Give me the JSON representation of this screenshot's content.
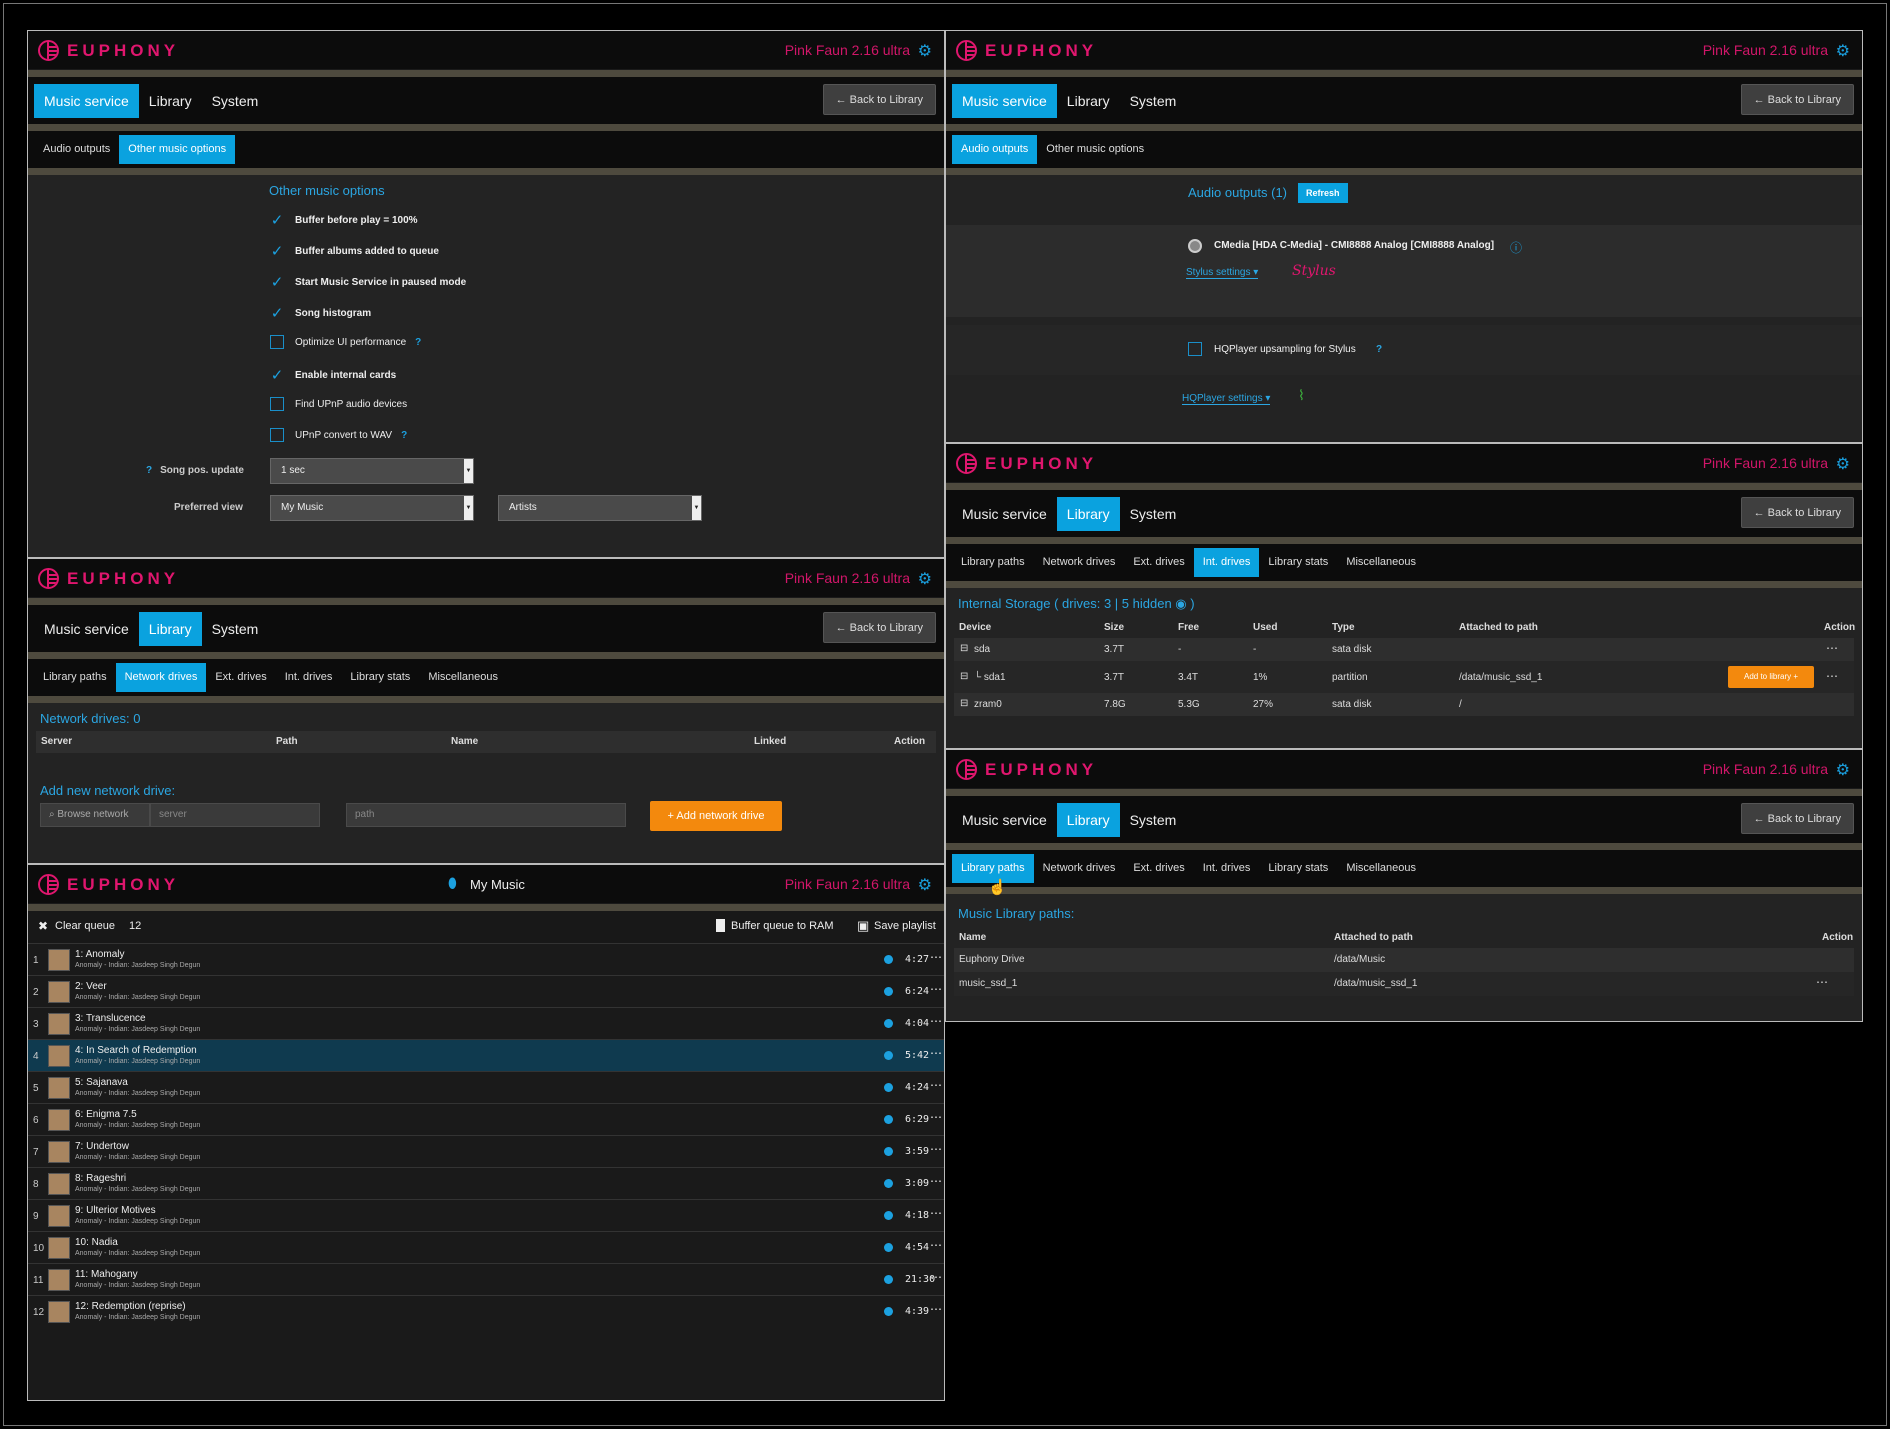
{
  "brand": {
    "logo": "EUPHONY",
    "version": "Pink Faun 2.16 ultra"
  },
  "tabs": {
    "music_service": "Music service",
    "library": "Library",
    "system": "System",
    "back": "← Back to Library"
  },
  "music_subtabs": {
    "audio_outputs": "Audio outputs",
    "other_options": "Other music options"
  },
  "library_subtabs": {
    "paths": "Library paths",
    "network": "Network drives",
    "ext": "Ext. drives",
    "int": "Int. drives",
    "stats": "Library stats",
    "misc": "Miscellaneous"
  },
  "other_options": {
    "title": "Other music options",
    "items": [
      {
        "label": "Buffer before play = 100%",
        "checked": true
      },
      {
        "label": "Buffer albums added to queue",
        "checked": true
      },
      {
        "label": "Start Music Service in paused mode",
        "checked": true
      },
      {
        "label": "Song histogram",
        "checked": true
      },
      {
        "label": "Optimize UI performance",
        "checked": false,
        "help": "?"
      },
      {
        "label": "Enable internal cards",
        "checked": true
      },
      {
        "label": "Find UPnP audio devices",
        "checked": false
      },
      {
        "label": "UPnP convert to WAV",
        "checked": false,
        "help": "?"
      }
    ],
    "song_pos_label": "Song pos. update",
    "song_pos_help": "?",
    "song_pos_value": "1 sec",
    "preferred_view_label": "Preferred view",
    "preferred_view_value": "My Music",
    "preferred_view_value2": "Artists"
  },
  "network_drives": {
    "title": "Network drives: 0",
    "columns": [
      "Server",
      "Path",
      "Name",
      "Linked",
      "Action"
    ],
    "add_title": "Add new network drive:",
    "browse": "Browse network",
    "server_ph": "server",
    "path_ph": "path",
    "add_button": "+ Add network drive"
  },
  "queue": {
    "location": "My Music",
    "clear": "Clear queue",
    "count": "12",
    "buffer": "Buffer queue to RAM",
    "save": "Save playlist",
    "rows": [
      {
        "n": "1",
        "title": "1: Anomaly",
        "sub": "Anomaly - Indian: Jasdeep Singh Degun",
        "dur": "4:27"
      },
      {
        "n": "2",
        "title": "2: Veer",
        "sub": "Anomaly - Indian: Jasdeep Singh Degun",
        "dur": "6:24"
      },
      {
        "n": "3",
        "title": "3: Translucence",
        "sub": "Anomaly - Indian: Jasdeep Singh Degun",
        "dur": "4:04"
      },
      {
        "n": "4",
        "title": "4: In Search of Redemption",
        "sub": "Anomaly - Indian: Jasdeep Singh Degun",
        "dur": "5:42",
        "active": true
      },
      {
        "n": "5",
        "title": "5: Sajanava",
        "sub": "Anomaly - Indian: Jasdeep Singh Degun",
        "dur": "4:24"
      },
      {
        "n": "6",
        "title": "6: Enigma 7.5",
        "sub": "Anomaly - Indian: Jasdeep Singh Degun",
        "dur": "6:29"
      },
      {
        "n": "7",
        "title": "7: Undertow",
        "sub": "Anomaly - Indian: Jasdeep Singh Degun",
        "dur": "3:59"
      },
      {
        "n": "8",
        "title": "8: Rageshri",
        "sub": "Anomaly - Indian: Jasdeep Singh Degun",
        "dur": "3:09"
      },
      {
        "n": "9",
        "title": "9: Ulterior Motives",
        "sub": "Anomaly - Indian: Jasdeep Singh Degun",
        "dur": "4:18"
      },
      {
        "n": "10",
        "title": "10: Nadia",
        "sub": "Anomaly - Indian: Jasdeep Singh Degun",
        "dur": "4:54"
      },
      {
        "n": "11",
        "title": "11: Mahogany",
        "sub": "Anomaly - Indian: Jasdeep Singh Degun",
        "dur": "21:30"
      },
      {
        "n": "12",
        "title": "12: Redemption (reprise)",
        "sub": "Anomaly - Indian: Jasdeep Singh Degun",
        "dur": "4:39"
      }
    ]
  },
  "audio_outputs": {
    "title": "Audio outputs (1)",
    "refresh": "Refresh",
    "device": "CMedia [HDA C-Media] - CMI8888 Analog [CMI8888 Analog]",
    "stylus_settings": "Stylus settings",
    "stylus_logo": "Stylus",
    "hqplayer_upsampling": "HQPlayer upsampling for Stylus",
    "hqplayer_help": "?",
    "hqplayer_settings": "HQPlayer settings"
  },
  "int_drives": {
    "title": "Internal Storage ( drives: 3 | 5 hidden",
    "title_end": ")",
    "columns": [
      "Device",
      "Size",
      "Free",
      "Used",
      "Type",
      "Attached to path",
      "Action"
    ],
    "rows": [
      {
        "device": "sda",
        "size": "3.7T",
        "free": "-",
        "used": "-",
        "type": "sata disk",
        "path": ""
      },
      {
        "device": "└ sda1",
        "size": "3.7T",
        "free": "3.4T",
        "used": "1%",
        "type": "partition",
        "path": "/data/music_ssd_1",
        "button": "Add to library +"
      },
      {
        "device": "zram0",
        "size": "7.8G",
        "free": "5.3G",
        "used": "27%",
        "type": "sata disk",
        "path": "/"
      }
    ]
  },
  "library_paths": {
    "title": "Music Library paths:",
    "columns": [
      "Name",
      "Attached to path",
      "Action"
    ],
    "rows": [
      {
        "name": "Euphony Drive",
        "path": "/data/Music"
      },
      {
        "name": "music_ssd_1",
        "path": "/data/music_ssd_1"
      }
    ]
  }
}
